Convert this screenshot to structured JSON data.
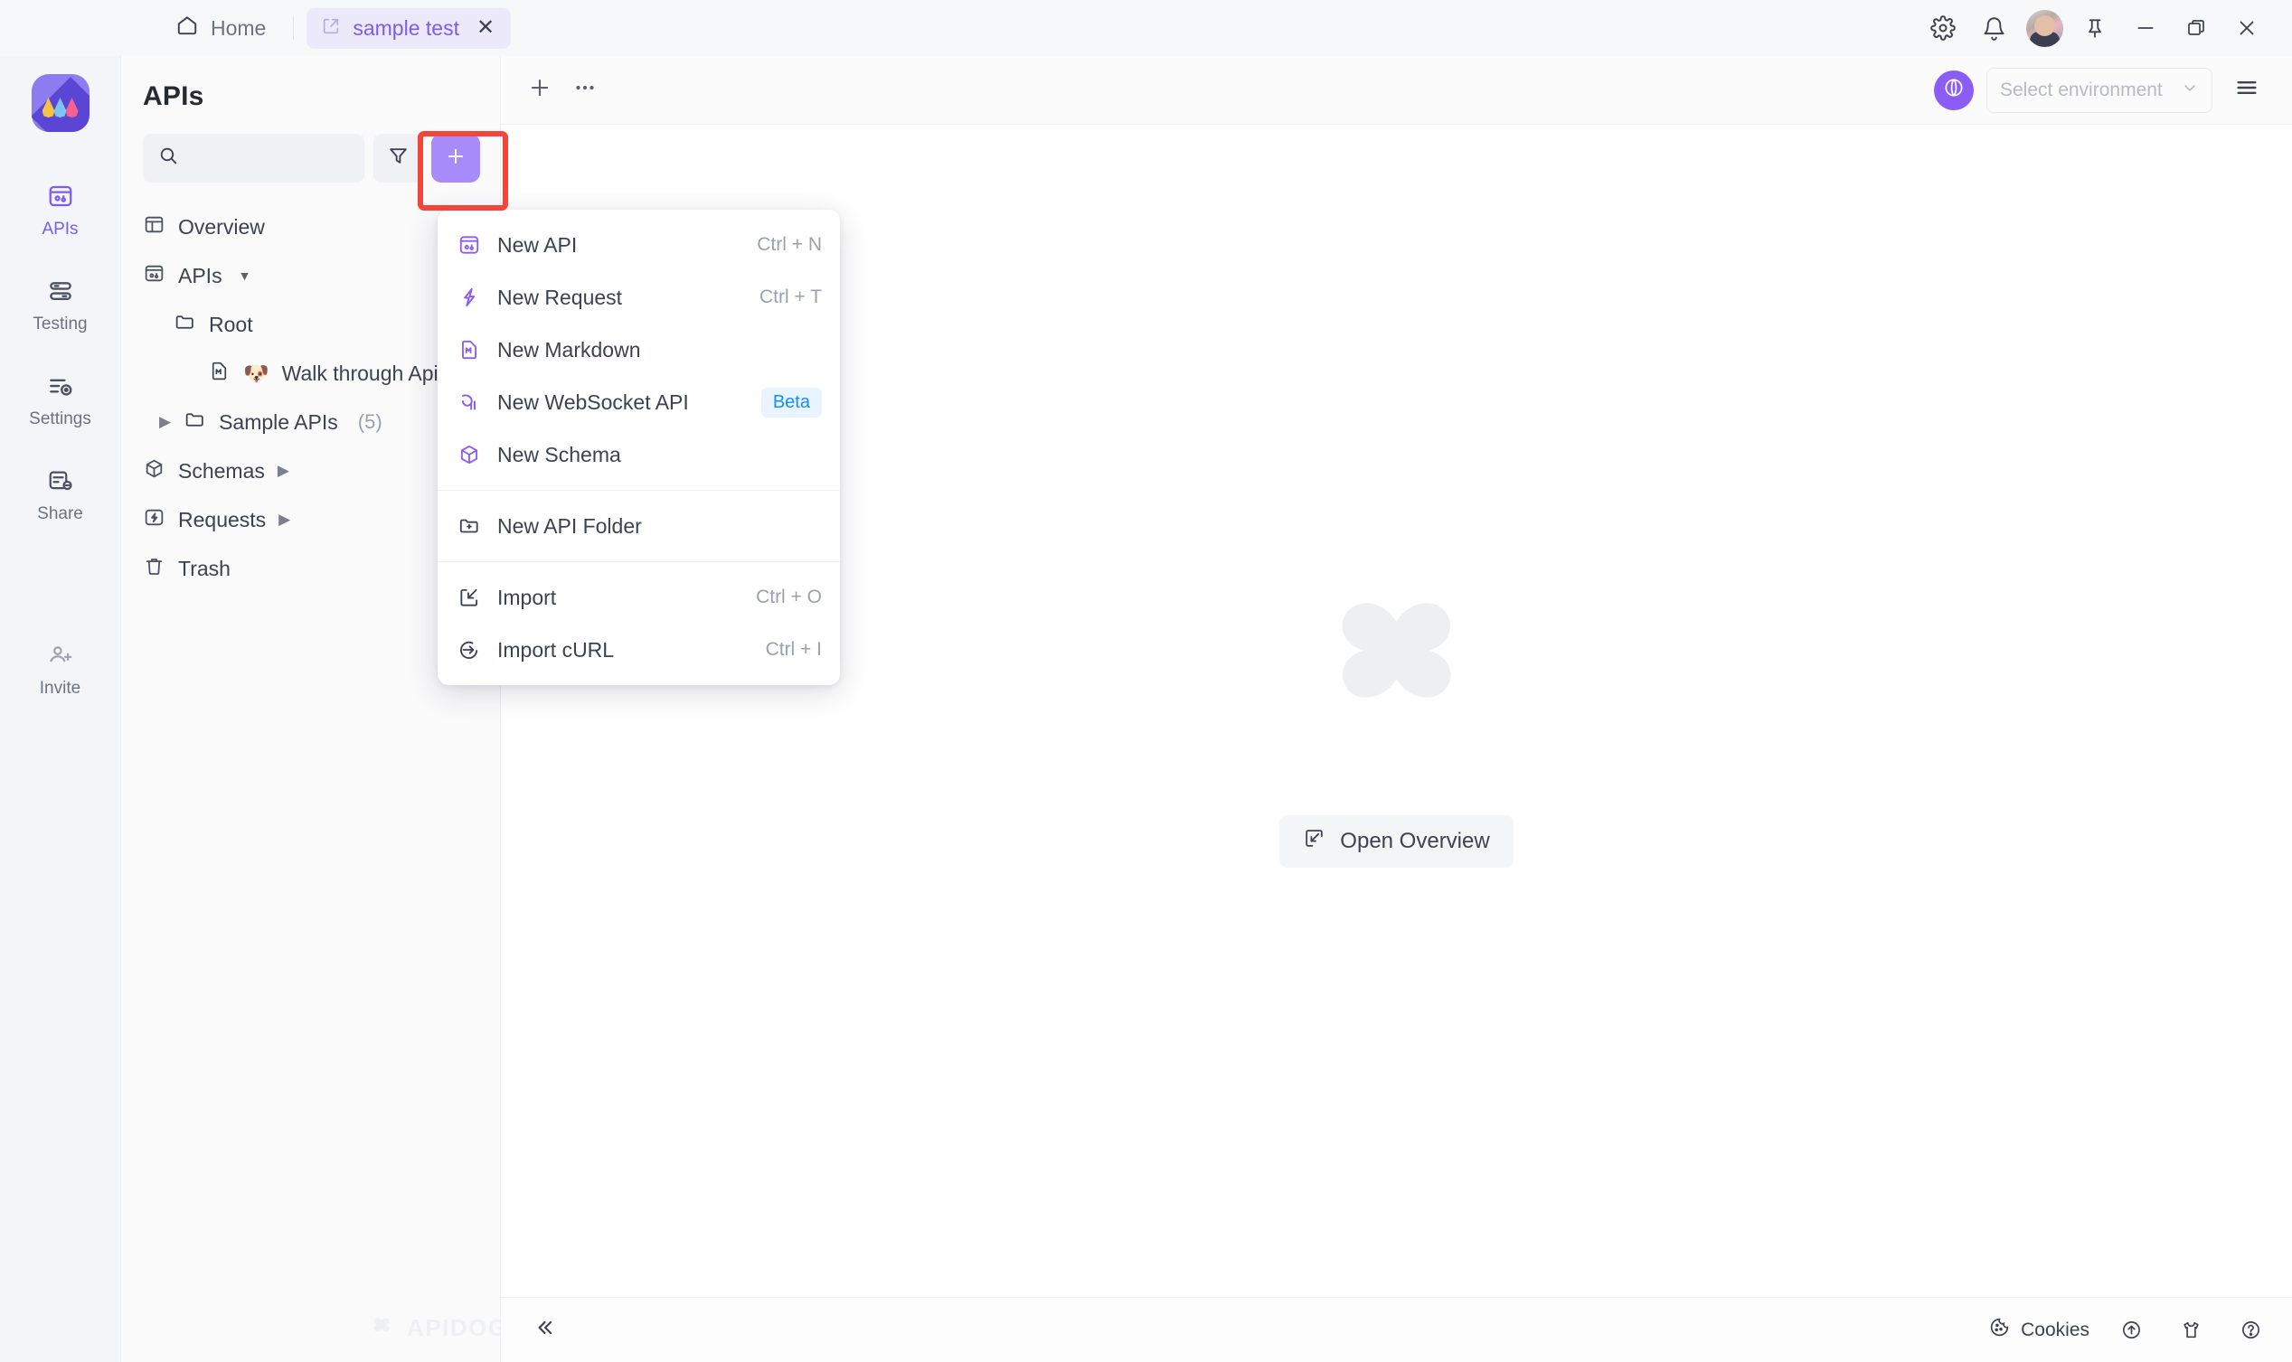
{
  "titlebar": {
    "home_label": "Home",
    "tab_label": "sample test",
    "icons": {
      "home": "home-icon",
      "tab_external": "external-link-icon",
      "tab_close": "close-icon",
      "settings": "gear-icon",
      "notifications": "bell-icon",
      "avatar": "user-avatar",
      "pin": "pin-icon",
      "minimize": "minimize-icon",
      "maximize": "maximize-icon",
      "close": "window-close-icon"
    }
  },
  "rail": {
    "logo": "apidog-logo",
    "items": [
      {
        "label": "APIs",
        "icon": "apis-icon",
        "active": true
      },
      {
        "label": "Testing",
        "icon": "testing-icon",
        "active": false
      },
      {
        "label": "Settings",
        "icon": "settings-icon",
        "active": false
      },
      {
        "label": "Share",
        "icon": "share-icon",
        "active": false
      },
      {
        "label": "Invite",
        "icon": "invite-icon",
        "active": false
      }
    ]
  },
  "sidebar": {
    "title": "APIs",
    "search_placeholder": "",
    "search_value": "",
    "filter_icon": "filter-icon",
    "add_icon": "plus-icon",
    "tree": [
      {
        "label": "Overview",
        "icon": "overview-icon",
        "indent": 0
      },
      {
        "label": "APIs",
        "icon": "apis-icon",
        "indent": 0,
        "caret": "down"
      },
      {
        "label": "Root",
        "icon": "folder-icon",
        "indent": 1
      },
      {
        "label": "Walk through Apid",
        "icon": "markdown-icon",
        "emoji": "🐶",
        "indent": 2
      },
      {
        "label": "Sample APIs",
        "icon": "folder-icon",
        "indent": 1,
        "caret": "right",
        "count": "(5)"
      },
      {
        "label": "Schemas",
        "icon": "schema-icon",
        "indent": 0,
        "caret": "right"
      },
      {
        "label": "Requests",
        "icon": "request-icon",
        "indent": 0,
        "caret": "right"
      },
      {
        "label": "Trash",
        "icon": "trash-icon",
        "indent": 0
      }
    ],
    "watermark": "APIDOG"
  },
  "menu": {
    "items": [
      {
        "label": "New API",
        "shortcut": "Ctrl + N",
        "icon": "api-icon",
        "badge": ""
      },
      {
        "label": "New Request",
        "shortcut": "Ctrl + T",
        "icon": "lightning-icon",
        "badge": ""
      },
      {
        "label": "New Markdown",
        "shortcut": "",
        "icon": "markdown-icon",
        "badge": ""
      },
      {
        "label": "New WebSocket API",
        "shortcut": "",
        "icon": "websocket-icon",
        "badge": "Beta"
      },
      {
        "label": "New Schema",
        "shortcut": "",
        "icon": "cube-icon",
        "badge": "",
        "sep_after": true
      },
      {
        "label": "New API Folder",
        "shortcut": "",
        "icon": "folder-plus-icon",
        "badge": "",
        "sep_after": true
      },
      {
        "label": "Import",
        "shortcut": "Ctrl + O",
        "icon": "import-icon",
        "badge": ""
      },
      {
        "label": "Import cURL",
        "shortcut": "Ctrl + I",
        "icon": "import-curl-icon",
        "badge": ""
      }
    ]
  },
  "main": {
    "toolbar": {
      "add_icon": "plus-icon",
      "more_icon": "more-horizontal-icon",
      "env_globe_icon": "globe-icon",
      "env_placeholder": "Select environment",
      "env_chevron": "chevron-down-icon",
      "burger_icon": "menu-icon"
    },
    "empty_state": {
      "logo": "apidog-watermark-logo",
      "button_label": "Open Overview",
      "button_icon": "open-panel-icon"
    },
    "statusbar": {
      "collapse_icon": "chevron-double-left-icon",
      "cookies_label": "Cookies",
      "cookies_icon": "cookie-icon",
      "upload_icon": "upload-circle-icon",
      "shirt_icon": "theme-shirt-icon",
      "help_icon": "help-circle-icon"
    }
  },
  "highlight": {
    "color": "#f4453b",
    "target": "sidebar-add-button"
  },
  "colors": {
    "accent": "#7c5cf0",
    "add_button": "#a78bfa",
    "badge_beta_bg": "#e8f4ff",
    "badge_beta_fg": "#1b8cf5",
    "page_bg": "#f7f8fa",
    "sidebar_bg": "#fafafb"
  }
}
